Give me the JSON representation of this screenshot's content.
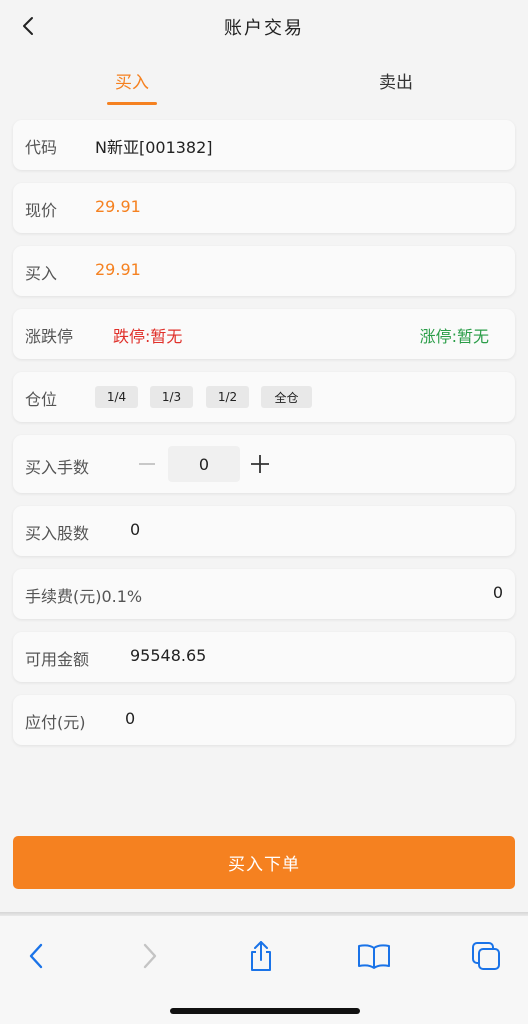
{
  "header": {
    "title": "账户交易"
  },
  "tabs": {
    "buy": "买入",
    "sell": "卖出"
  },
  "form": {
    "code_label": "代码",
    "code_value": "N新亚[001382]",
    "price_label": "现价",
    "price_value": "29.91",
    "buy_label": "买入",
    "buy_value": "29.91",
    "limit_label": "涨跌停",
    "limit_down": "跌停:暂无",
    "limit_up": "涨停:暂无",
    "position_label": "仓位",
    "position_options": [
      "1/4",
      "1/3",
      "1/2",
      "全仓"
    ],
    "lots_label": "买入手数",
    "lots_value": "0",
    "shares_label": "买入股数",
    "shares_value": "0",
    "fee_label": "手续费(元)0.1%",
    "fee_value": "0",
    "available_label": "可用金额",
    "available_value": "95548.65",
    "payable_label": "应付(元)",
    "payable_value": "0"
  },
  "submit_label": "买入下单",
  "colors": {
    "accent": "#f58120",
    "limit_down": "#e0302a",
    "limit_up": "#2a9d48",
    "browser_blue": "#1a73e8"
  }
}
